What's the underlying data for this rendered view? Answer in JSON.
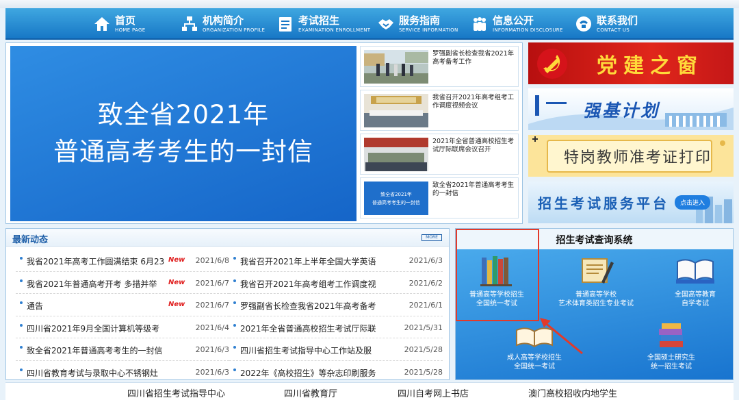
{
  "nav": {
    "items": [
      {
        "cn": "首页",
        "en": "HOME PAGE"
      },
      {
        "cn": "机构简介",
        "en": "ORGANIZATION PROFILE"
      },
      {
        "cn": "考试招生",
        "en": "EXAMINATION ENROLLMENT"
      },
      {
        "cn": "服务指南",
        "en": "SERVICE INFORMATION"
      },
      {
        "cn": "信息公开",
        "en": "INFORMATION DISCLOSURE"
      },
      {
        "cn": "联系我们",
        "en": "CONTACT US"
      }
    ]
  },
  "banner": {
    "line1": "致全省2021年",
    "line2": "普通高考考生的一封信"
  },
  "news": [
    {
      "title": "罗强副省长检查我省2021年高考备考工作"
    },
    {
      "title": "我省召开2021年高考组考工作调度视频会议"
    },
    {
      "title": "2021年全省普通高校招生考试厅际联席会议召开"
    },
    {
      "title": "致全省2021年普通高考考生的一封信",
      "thumb_line1": "致全省2021年",
      "thumb_line2": "普通高考考生的一封信"
    }
  ],
  "side": {
    "party": "党建之窗",
    "qiangji": "强基计划",
    "teacher": "特岗教师准考证打印",
    "platform": "招生考试服务平台",
    "platform_btn": "点击进入"
  },
  "latest": {
    "title": "最新动态",
    "more": "MORE",
    "new_tag": "New",
    "left": [
      {
        "title": "我省2021年高考工作圆满结束 6月23",
        "new": true,
        "date": "2021/6/8"
      },
      {
        "title": "我省2021年普通高考开考 多措并举",
        "new": true,
        "date": "2021/6/7"
      },
      {
        "title": "通告",
        "new": true,
        "date": "2021/6/7"
      },
      {
        "title": "四川省2021年9月全国计算机等级考",
        "new": false,
        "date": "2021/6/4"
      },
      {
        "title": "致全省2021年普通高考考生的一封信",
        "new": false,
        "date": "2021/6/3"
      },
      {
        "title": "四川省教育考试与录取中心不锈钢灶",
        "new": false,
        "date": "2021/6/3"
      }
    ],
    "right": [
      {
        "title": "我省召开2021年上半年全国大学英语",
        "date": "2021/6/3"
      },
      {
        "title": "我省召开2021年高考组考工作调度视",
        "date": "2021/6/2"
      },
      {
        "title": "罗强副省长检查我省2021年高考备考",
        "date": "2021/6/1"
      },
      {
        "title": "2021年全省普通高校招生考试厅际联",
        "date": "2021/5/31"
      },
      {
        "title": "四川省招生考试指导中心工作站及服",
        "date": "2021/5/28"
      },
      {
        "title": "2022年《高校招生》等杂志印刷服务",
        "date": "2021/5/28"
      }
    ]
  },
  "query": {
    "title": "招生考试查询系统",
    "items": [
      {
        "line1": "普通高等学校招生",
        "line2": "全国统一考试"
      },
      {
        "line1": "普通高等学校",
        "line2": "艺术体育类招生专业考试"
      },
      {
        "line1": "全国高等教育",
        "line2": "自学考试"
      },
      {
        "line1": "成人高等学校招生",
        "line2": "全国统一考试"
      },
      {
        "line1": "全国硕士研究生",
        "line2": "统一招生考试"
      }
    ]
  },
  "footer": {
    "links": [
      "四川省招生考试指导中心",
      "四川省教育厅",
      "四川自考网上书店",
      "澳门高校招收内地学生"
    ]
  },
  "colors": {
    "nav": "#1777c6",
    "accent_blue": "#1565c8",
    "new_red": "#e02020",
    "highlight_red": "#e23a2a"
  }
}
